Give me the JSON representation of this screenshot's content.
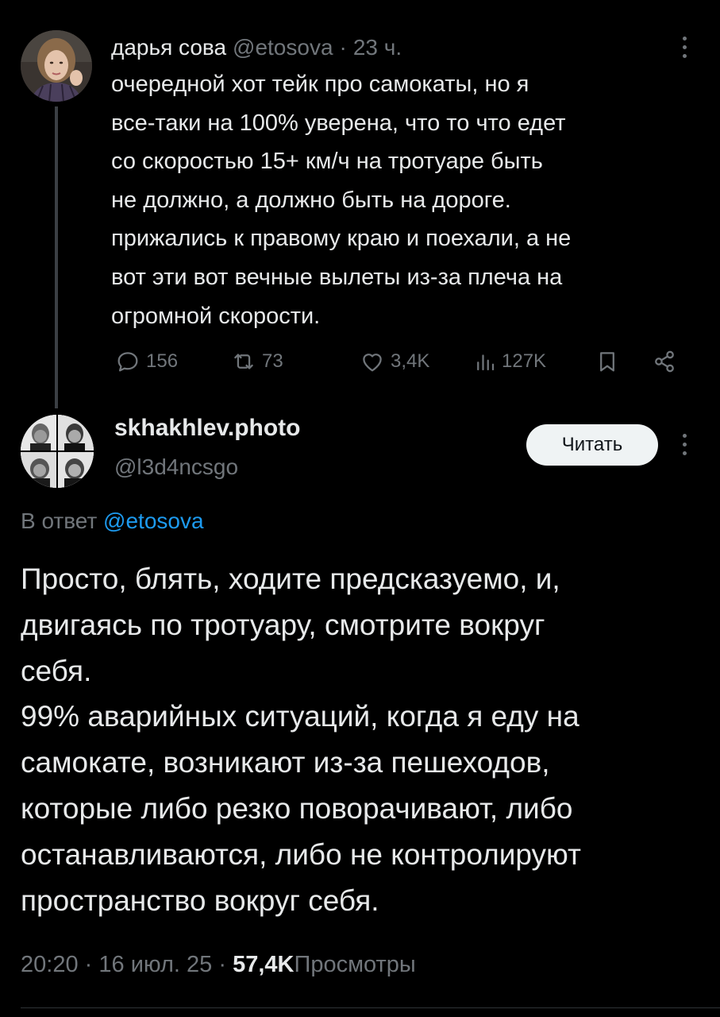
{
  "parent_tweet": {
    "display_name": "дарья сова",
    "handle": "@etosova",
    "separator": "·",
    "time_ago": "23 ч.",
    "text": "очередной хот тейк про самокаты, но я\nвсе-таки на 100% уверена, что то что едет\nсо скоростью 15+ км/ч на тротуаре быть\nне должно, а должно быть на дороге.\nприжались к правому краю и поехали, а не\nвот эти вот вечные вылеты из-за плеча на\nогромной скорости.",
    "stats": {
      "replies": "156",
      "retweets": "73",
      "likes": "3,4K",
      "views": "127K"
    },
    "icons": [
      "more-icon",
      "reply-icon",
      "retweet-icon",
      "like-icon",
      "views-icon",
      "bookmark-icon",
      "share-icon"
    ]
  },
  "reply_tweet": {
    "display_name": "skhakhlev.photo",
    "handle": "@l3d4ncsgo",
    "follow_label": "Читать",
    "reply_prefix": "В ответ",
    "reply_to": "@etosova",
    "text": "Просто, блять, ходите предсказуемо, и,\nдвигаясь по тротуару, смотрите вокруг\nсебя.\n99% аварийных ситуаций, когда я еду на\nсамокате, возникают из-за пешеходов,\nкоторые либо резко поворачивают, либо\nостанавливаются, либо не контролируют\nпространство вокруг себя.",
    "time": "20:20",
    "date": "16 июл. 25",
    "separator": "·",
    "views_count": "57,4K",
    "views_label": "Просмотры"
  },
  "colors": {
    "background": "#000000",
    "text": "#e7e9ea",
    "muted": "#71767b",
    "link": "#1d9bf0",
    "thread_line": "#3b3f44",
    "button_bg": "#eff3f4"
  }
}
